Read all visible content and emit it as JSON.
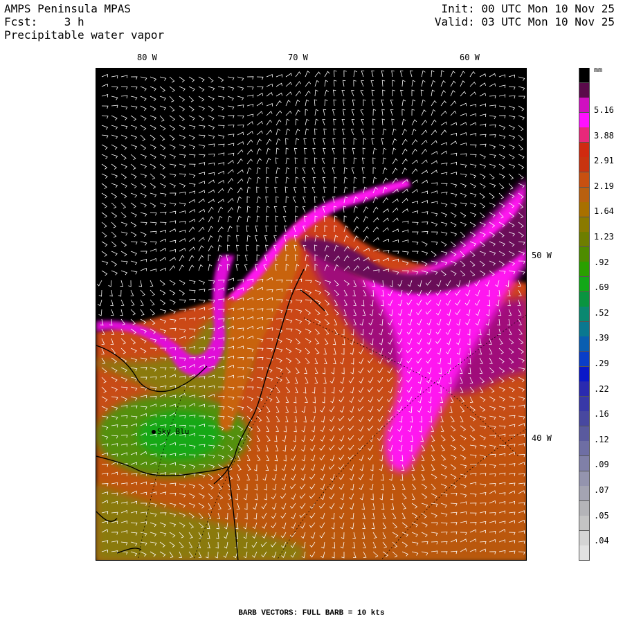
{
  "header": {
    "model": "AMPS Peninsula MPAS",
    "forecast_label": "Fcst:",
    "forecast_value": "3 h",
    "field": "Precipitable water vapor",
    "init_label": "Init:",
    "init_value": "00 UTC Mon 10 Nov 25",
    "valid_label": "Valid:",
    "valid_value": "03 UTC Mon 10 Nov 25"
  },
  "axes": {
    "longitude_labels": [
      "80 W",
      "70 W",
      "60 W"
    ],
    "latitude_labels": [
      "50 W",
      "40 W"
    ]
  },
  "station": {
    "name": "Sky Blu"
  },
  "colorbar": {
    "unit": "mm",
    "labels": [
      "5.16",
      "3.88",
      "2.91",
      "2.19",
      "1.64",
      "1.23",
      ".92",
      ".69",
      ".52",
      ".39",
      ".29",
      ".22",
      ".16",
      ".12",
      ".09",
      ".07",
      ".05",
      ".04"
    ],
    "colors": [
      "#000000",
      "#5a0a4a",
      "#d010c0",
      "#ff10ff",
      "#e8287a",
      "#d02a10",
      "#c83410",
      "#c85010",
      "#b86010",
      "#a87000",
      "#8a7a00",
      "#6e7e00",
      "#4e8c00",
      "#2aa000",
      "#12a818",
      "#0a9440",
      "#0a8870",
      "#0a7890",
      "#0a5eb0",
      "#0a3ec8",
      "#0a18c8",
      "#2a2ab0",
      "#3838a8",
      "#4848a0",
      "#5a5a9e",
      "#6e6ea4",
      "#8080a8",
      "#9494ae",
      "#a4a4b2",
      "#b4b4b8",
      "#c4c4c4",
      "#d4d4d4",
      "#e2e2e2"
    ]
  },
  "footer": {
    "text": "BARB VECTORS:  FULL BARB = 10 kts"
  }
}
